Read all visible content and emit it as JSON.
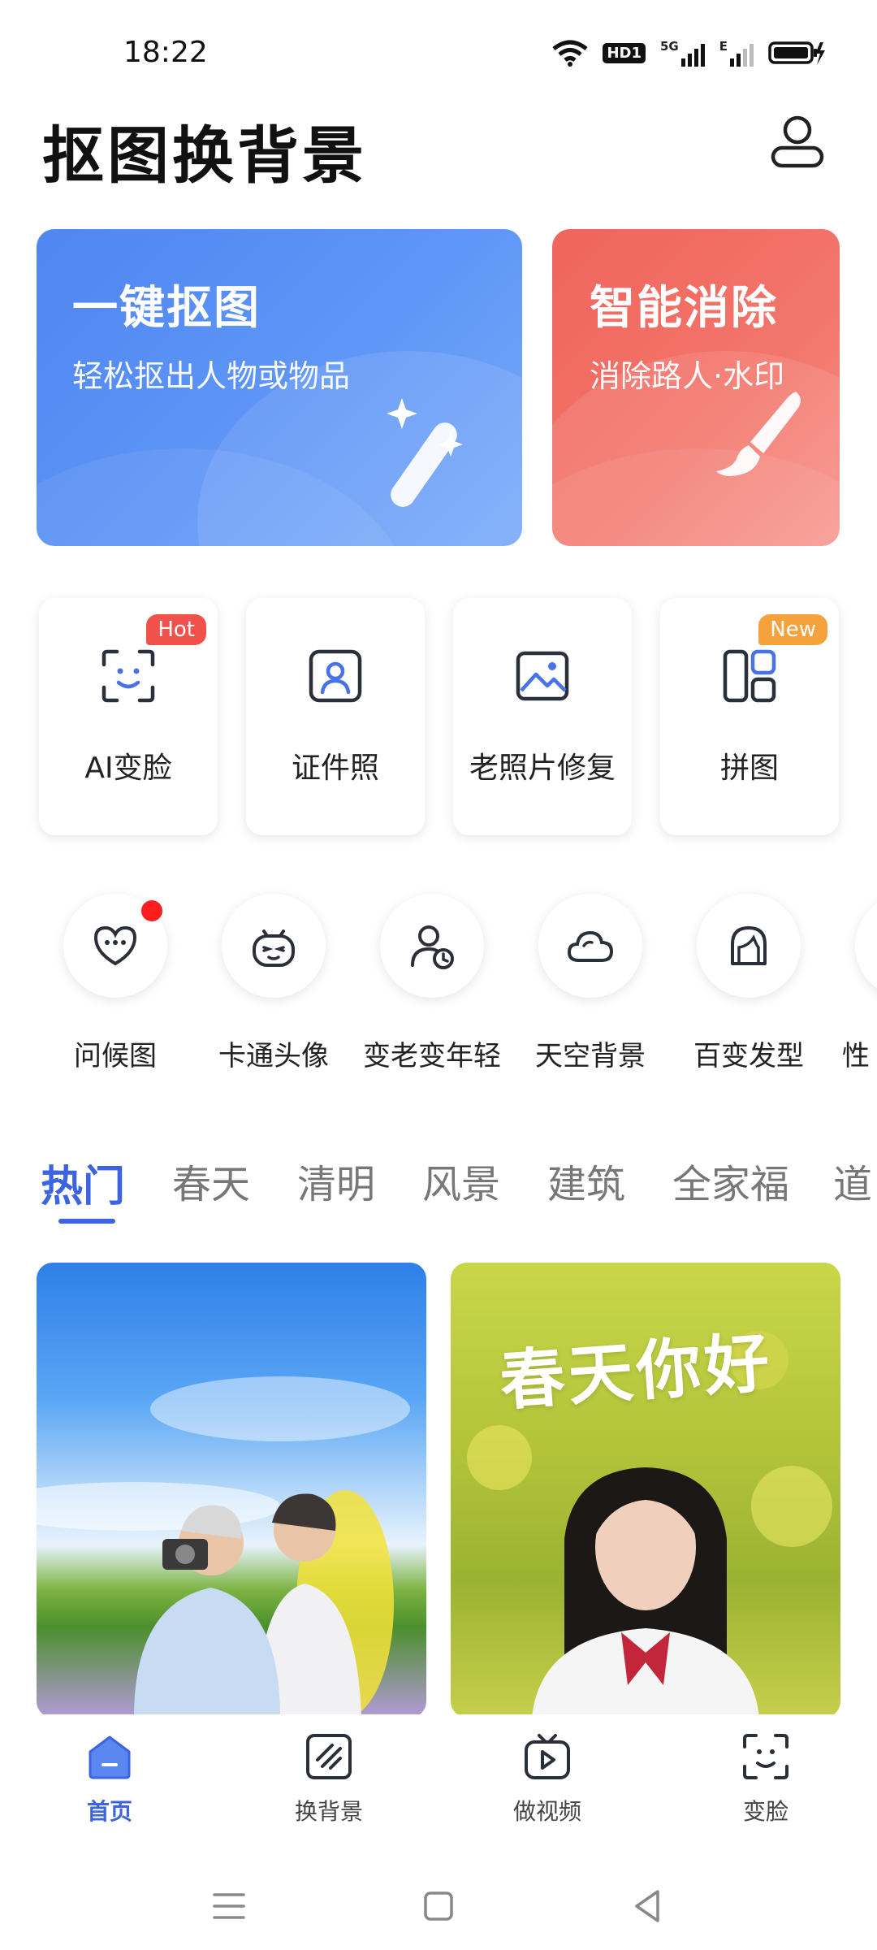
{
  "status_bar": {
    "time": "18:22",
    "hd_label": "HD1",
    "network_5g": "5G",
    "network_e": "E"
  },
  "header": {
    "title": "抠图换背景",
    "profile_icon": "user-icon"
  },
  "feature_cards": [
    {
      "title": "一键抠图",
      "subtitle": "轻松抠出人物或物品",
      "icon": "magic-wand-icon",
      "color": "#5b8ff5"
    },
    {
      "title": "智能消除",
      "subtitle": "消除路人·水印",
      "icon": "brush-icon",
      "color": "#f26c63"
    }
  ],
  "tool_grid": [
    {
      "label": "AI变脸",
      "badge": "Hot",
      "icon": "face-scan-icon"
    },
    {
      "label": "证件照",
      "badge": "",
      "icon": "id-photo-icon"
    },
    {
      "label": "老照片修复",
      "badge": "",
      "icon": "image-icon"
    },
    {
      "label": "拼图",
      "badge": "New",
      "icon": "collage-icon"
    }
  ],
  "round_tools": [
    {
      "label": "问候图",
      "icon": "heart-chat-icon",
      "dot": true
    },
    {
      "label": "卡通头像",
      "icon": "cartoon-face-icon"
    },
    {
      "label": "变老变年轻",
      "icon": "person-clock-icon"
    },
    {
      "label": "天空背景",
      "icon": "cloud-icon"
    },
    {
      "label": "百变发型",
      "icon": "hairstyle-icon"
    },
    {
      "label": "性",
      "icon": "partial-icon"
    }
  ],
  "tabs": [
    "热门",
    "春天",
    "清明",
    "风景",
    "建筑",
    "全家福",
    "道"
  ],
  "active_tab": 0,
  "photos": [
    {
      "overlay_text": ""
    },
    {
      "overlay_text": "春天你好"
    }
  ],
  "bottom_nav": [
    {
      "label": "首页",
      "icon": "home-icon",
      "active": true
    },
    {
      "label": "换背景",
      "icon": "replace-background-icon",
      "active": false
    },
    {
      "label": "做视频",
      "icon": "video-icon",
      "active": false
    },
    {
      "label": "变脸",
      "icon": "face-scan-icon",
      "active": false
    }
  ],
  "accent_color": "#3c64e0"
}
